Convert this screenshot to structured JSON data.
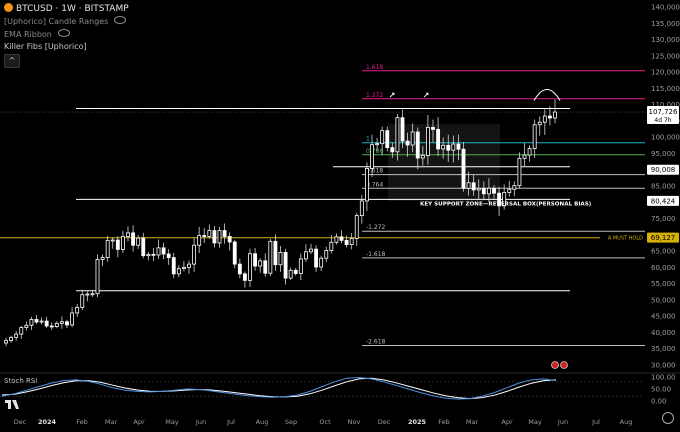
{
  "header": {
    "symbol": "BTCUSD",
    "interval": "1W",
    "exchange": "BITSTAMP",
    "title": "BTCUSD · 1W · BITSTAMP",
    "indicators": [
      "[Uphorico] Candle Ranges",
      "EMA Ribbon",
      "Killer Fibs [Uphorico]"
    ],
    "collapse_glyph": "^"
  },
  "chart_data": {
    "type": "candlestick",
    "y_axis": {
      "ticks": [
        30000,
        35000,
        40000,
        45000,
        50000,
        55000,
        60000,
        65000,
        70000,
        75000,
        80000,
        85000,
        90000,
        95000,
        100000,
        105000,
        110000,
        115000,
        120000,
        125000,
        130000,
        135000,
        140000
      ],
      "tick_labels": [
        "30,000",
        "35,000",
        "40,000",
        "45,000",
        "50,000",
        "55,000",
        "60,000",
        "65,000",
        "70,000",
        "75,000",
        "80,000",
        "85,000",
        "90,000",
        "95,000",
        "100,000",
        "105,000",
        "110,000",
        "115,000",
        "120,000",
        "125,000",
        "130,000",
        "135,000",
        "140,000"
      ],
      "range": [
        29000,
        142000
      ]
    },
    "x_axis": {
      "labels": [
        "Dec",
        "2024",
        "Feb",
        "Mar",
        "Apr",
        "May",
        "Jun",
        "Jul",
        "Aug",
        "Sep",
        "Oct",
        "Nov",
        "Dec",
        "2025",
        "Feb",
        "Mar",
        "Apr",
        "May",
        "Jun",
        "Jul",
        "Aug"
      ]
    },
    "weekly_closes": [
      37500,
      38500,
      39500,
      41500,
      42200,
      44000,
      43200,
      43500,
      42000,
      41800,
      42800,
      43300,
      42300,
      46000,
      47700,
      51600,
      51800,
      51900,
      62400,
      63000,
      68300,
      68400,
      65500,
      69500,
      70600,
      66800,
      69000,
      63600,
      64000,
      63800,
      66000,
      64100,
      63000,
      58000,
      59600,
      60000,
      61000,
      66800,
      69800,
      69500,
      71300,
      67500,
      71300,
      69500,
      67800,
      61000,
      58000,
      56000,
      64200,
      60400,
      62000,
      58200,
      68000,
      60800,
      64600,
      56700,
      59100,
      58100,
      62600,
      64800,
      65600,
      60100,
      62800,
      65200,
      67700,
      69400,
      68300,
      67000,
      68900,
      75900,
      80400,
      90400,
      97700,
      98000,
      102000,
      96800,
      95500,
      106000,
      98800,
      97600,
      101600,
      93600,
      94400,
      103000,
      102400,
      96400,
      97500,
      96000,
      97900,
      96300,
      84300,
      86000,
      83800,
      84300,
      82600,
      84300,
      82800,
      78900,
      83000,
      84000,
      85100,
      93500,
      94500,
      96500,
      103800,
      104600,
      106500,
      105900,
      107726
    ],
    "current_price": "107,726",
    "countdown": "4d 7h",
    "price_labels": [
      {
        "text": "90,008",
        "value": 90008
      },
      {
        "text": "80,424",
        "value": 80424
      },
      {
        "text": "69,127",
        "value": 69127
      }
    ],
    "fib_levels": [
      {
        "label": "1.618",
        "value": 120400,
        "color": "#e91e8c"
      },
      {
        "label": "1.272",
        "value": 111800,
        "color": "#e91e8c"
      },
      {
        "label": "1",
        "value": 98300,
        "color": "#17b8c9"
      },
      {
        "label": "0.786",
        "value": 94600,
        "color": "#4caf50"
      },
      {
        "label": "0.618",
        "value": 88500,
        "color": "#bdbdbd"
      },
      {
        "label": "0.764",
        "value": 84300,
        "color": "#bdbdbd"
      },
      {
        "label": "-1.272",
        "value": 71100,
        "color": "#bdbdbd"
      },
      {
        "label": "-1.618",
        "value": 62900,
        "color": "#bdbdbd"
      },
      {
        "label": "-2.618",
        "value": 36000,
        "color": "#bdbdbd"
      }
    ],
    "horizontal_lines": [
      {
        "value": 108800,
        "color": "#ffffff"
      },
      {
        "value": 90900,
        "color": "#ffffff"
      },
      {
        "value": 80900,
        "color": "#ffffff"
      },
      {
        "value": 69100,
        "color": "#d4b106"
      },
      {
        "value": 52800,
        "color": "#ffffff"
      }
    ],
    "annotations": {
      "key_support": "KEY SUPPORT ZONE—REVERSAL BOX(PERSONAL BIAS)",
      "must_hold": "A MUST HOLD"
    },
    "oscillator": {
      "title": "Stoch RSI",
      "ticks": [
        0,
        50,
        100
      ],
      "tick_labels": [
        "0.00",
        "50.00",
        "100.00"
      ],
      "k": [
        20,
        30,
        45,
        60,
        75,
        85,
        88,
        82,
        70,
        55,
        45,
        40,
        38,
        40,
        45,
        50,
        48,
        42,
        35,
        28,
        22,
        18,
        16,
        18,
        25,
        40,
        60,
        80,
        95,
        98,
        92,
        80,
        65,
        50,
        35,
        22,
        12,
        8,
        10,
        20,
        35,
        55,
        75,
        88,
        92,
        85
      ],
      "d": [
        25,
        28,
        38,
        50,
        64,
        76,
        84,
        85,
        78,
        66,
        54,
        46,
        41,
        40,
        42,
        46,
        48,
        46,
        41,
        34,
        28,
        22,
        18,
        17,
        20,
        30,
        45,
        63,
        80,
        92,
        95,
        88,
        76,
        62,
        48,
        34,
        22,
        14,
        10,
        14,
        24,
        40,
        58,
        74,
        85,
        88
      ]
    }
  }
}
